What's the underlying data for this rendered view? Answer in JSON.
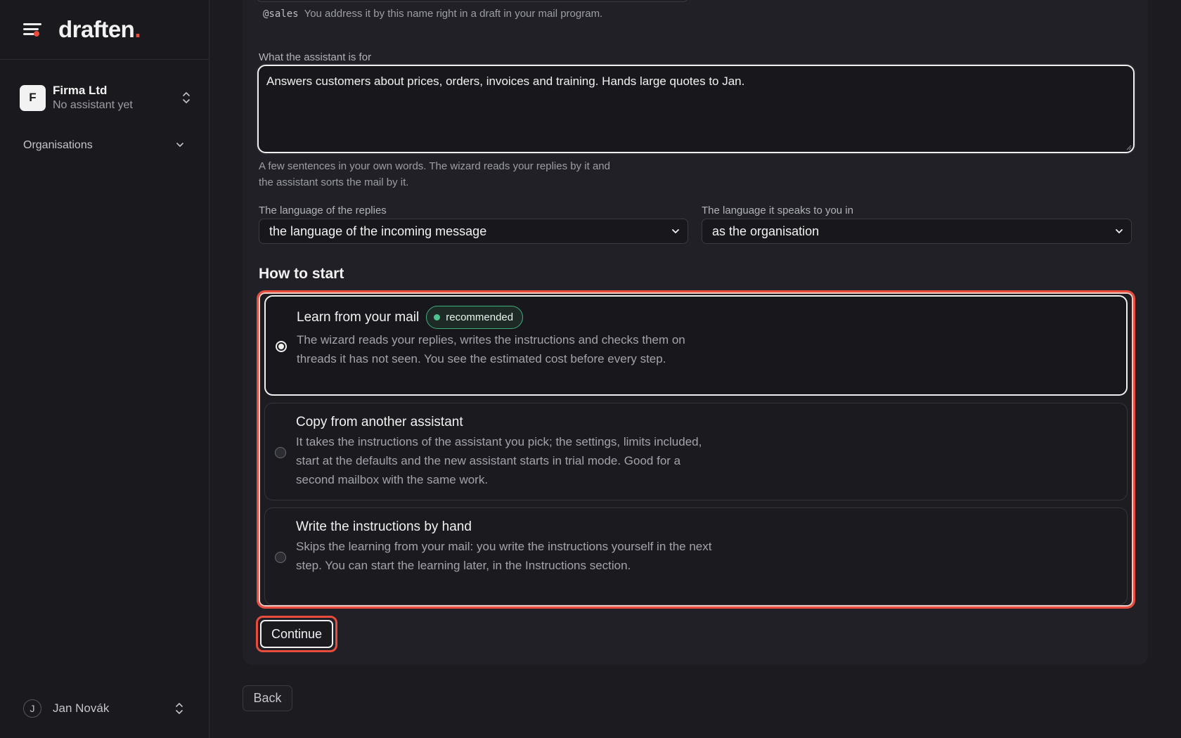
{
  "app": {
    "logo_text": "draften",
    "logo_dot": "."
  },
  "sidebar": {
    "org": {
      "initial": "F",
      "name": "Firma Ltd",
      "subtitle": "No assistant yet"
    },
    "section_label": "Organisations",
    "user": {
      "initial": "J",
      "name": "Jan Novák"
    }
  },
  "form": {
    "alias": {
      "code": "@sales",
      "hint": "You address it by this name right in a draft in your mail program."
    },
    "purpose": {
      "label": "What the assistant is for",
      "value": "Answers customers about prices, orders, invoices and training. Hands large quotes to Jan.",
      "hint": "A few sentences in your own words. The wizard reads your replies by it and the assistant sorts the mail by it."
    },
    "reply_language": {
      "label": "The language of the replies",
      "value": "the language of the incoming message"
    },
    "ui_language": {
      "label": "The language it speaks to you in",
      "value": "as the organisation"
    },
    "start": {
      "title": "How to start",
      "options": [
        {
          "title": "Learn from your mail",
          "badge": "recommended",
          "description": "The wizard reads your replies, writes the instructions and checks them on threads it has not seen. You see the estimated cost before every step.",
          "selected": true
        },
        {
          "title": "Copy from another assistant",
          "description": "It takes the instructions of the assistant you pick; the settings, limits included, start at the defaults and the new assistant starts in trial mode. Good for a second mailbox with the same work.",
          "selected": false
        },
        {
          "title": "Write the instructions by hand",
          "description": "Skips the learning from your mail: you write the instructions yourself in the next step. You can start the learning later, in the Instructions section.",
          "selected": false
        }
      ]
    },
    "continue_label": "Continue",
    "back_label": "Back"
  },
  "colors": {
    "accent": "#e74c3c",
    "badge_green": "#4cc48d",
    "background": "#1b1b20"
  }
}
